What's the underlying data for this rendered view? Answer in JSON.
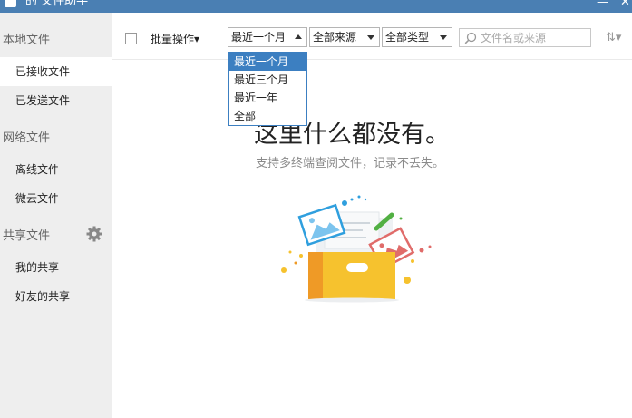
{
  "window": {
    "title": "的 文件助手",
    "minimize_glyph": "—",
    "close_glyph": "✕"
  },
  "sidebar": {
    "sections": [
      {
        "label": "本地文件",
        "items": [
          {
            "label": "已接收文件",
            "active": true
          },
          {
            "label": "已发送文件",
            "active": false
          }
        ]
      },
      {
        "label": "网络文件",
        "items": [
          {
            "label": "离线文件",
            "active": false
          },
          {
            "label": "微云文件",
            "active": false
          }
        ]
      },
      {
        "label": "共享文件",
        "items": [
          {
            "label": "我的共享",
            "active": false
          },
          {
            "label": "好友的共享",
            "active": false
          }
        ],
        "icon": "gear-icon"
      }
    ]
  },
  "toolbar": {
    "batch_label": "批量操作▾",
    "time_filter": "最近一个月",
    "source_filter": "全部来源",
    "type_filter": "全部类型",
    "search_placeholder": "文件名或来源",
    "sort_glyph": "⇅▾"
  },
  "time_dropdown": {
    "options": [
      "最近一个月",
      "最近三个月",
      "最近一年",
      "全部"
    ],
    "selected_index": 0
  },
  "empty_state": {
    "title": "这里什么都没有。",
    "subtitle": "支持多终端查阅文件，记录不丢失。"
  },
  "colors": {
    "titlebar": "#4a7fb3",
    "sidebar": "#eeeeee",
    "accent": "#3c7fc1",
    "box": "#f6c22e"
  }
}
